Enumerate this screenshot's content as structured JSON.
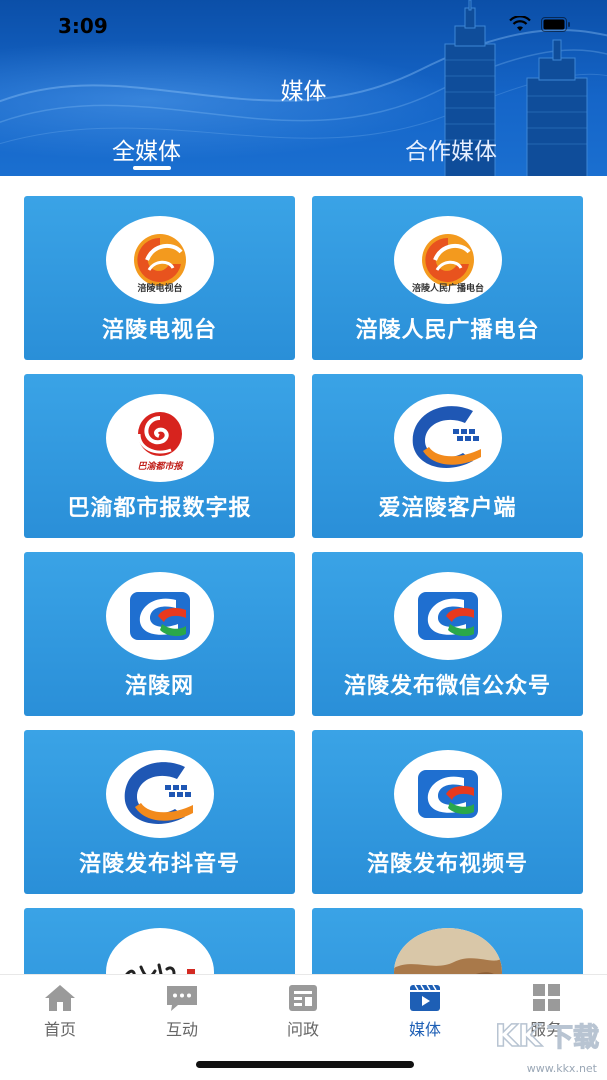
{
  "status_bar": {
    "time": "3:09"
  },
  "header": {
    "title": "媒体",
    "tabs": [
      {
        "label": "全媒体",
        "active": true
      },
      {
        "label": "合作媒体",
        "active": false
      }
    ]
  },
  "media": [
    {
      "label": "涪陵电视台",
      "logo": "fuling-tv-logo",
      "logo_caption": "涪陵电视台"
    },
    {
      "label": "涪陵人民广播电台",
      "logo": "fuling-radio-logo",
      "logo_caption": "涪陵人民广播电台"
    },
    {
      "label": "巴渝都市报数字报",
      "logo": "bayu-dushibao-logo",
      "logo_caption": "巴渝都市报"
    },
    {
      "label": "爱涪陵客户端",
      "logo": "ai-fuling-app-logo"
    },
    {
      "label": "涪陵网",
      "logo": "fuling-net-logo"
    },
    {
      "label": "涪陵发布微信公众号",
      "logo": "fuling-wechat-logo"
    },
    {
      "label": "涪陵发布抖音号",
      "logo": "fuling-douyin-logo"
    },
    {
      "label": "涪陵发布视频号",
      "logo": "fuling-video-logo"
    },
    {
      "label": "",
      "logo": "calligraphy-logo"
    },
    {
      "label": "",
      "logo": "landscape-photo-logo"
    }
  ],
  "bottom_nav": [
    {
      "label": "首页",
      "icon": "home-icon",
      "active": false
    },
    {
      "label": "互动",
      "icon": "chat-icon",
      "active": false
    },
    {
      "label": "问政",
      "icon": "inquiry-icon",
      "active": false
    },
    {
      "label": "媒体",
      "icon": "media-icon",
      "active": true
    },
    {
      "label": "服务",
      "icon": "grid-icon",
      "active": false
    }
  ],
  "watermark": {
    "text": "www.kkx.net"
  },
  "colors": {
    "header": "#1565c8",
    "card": "#2f98de",
    "nav_active": "#1e5fb5",
    "nav_inactive": "#888888"
  }
}
